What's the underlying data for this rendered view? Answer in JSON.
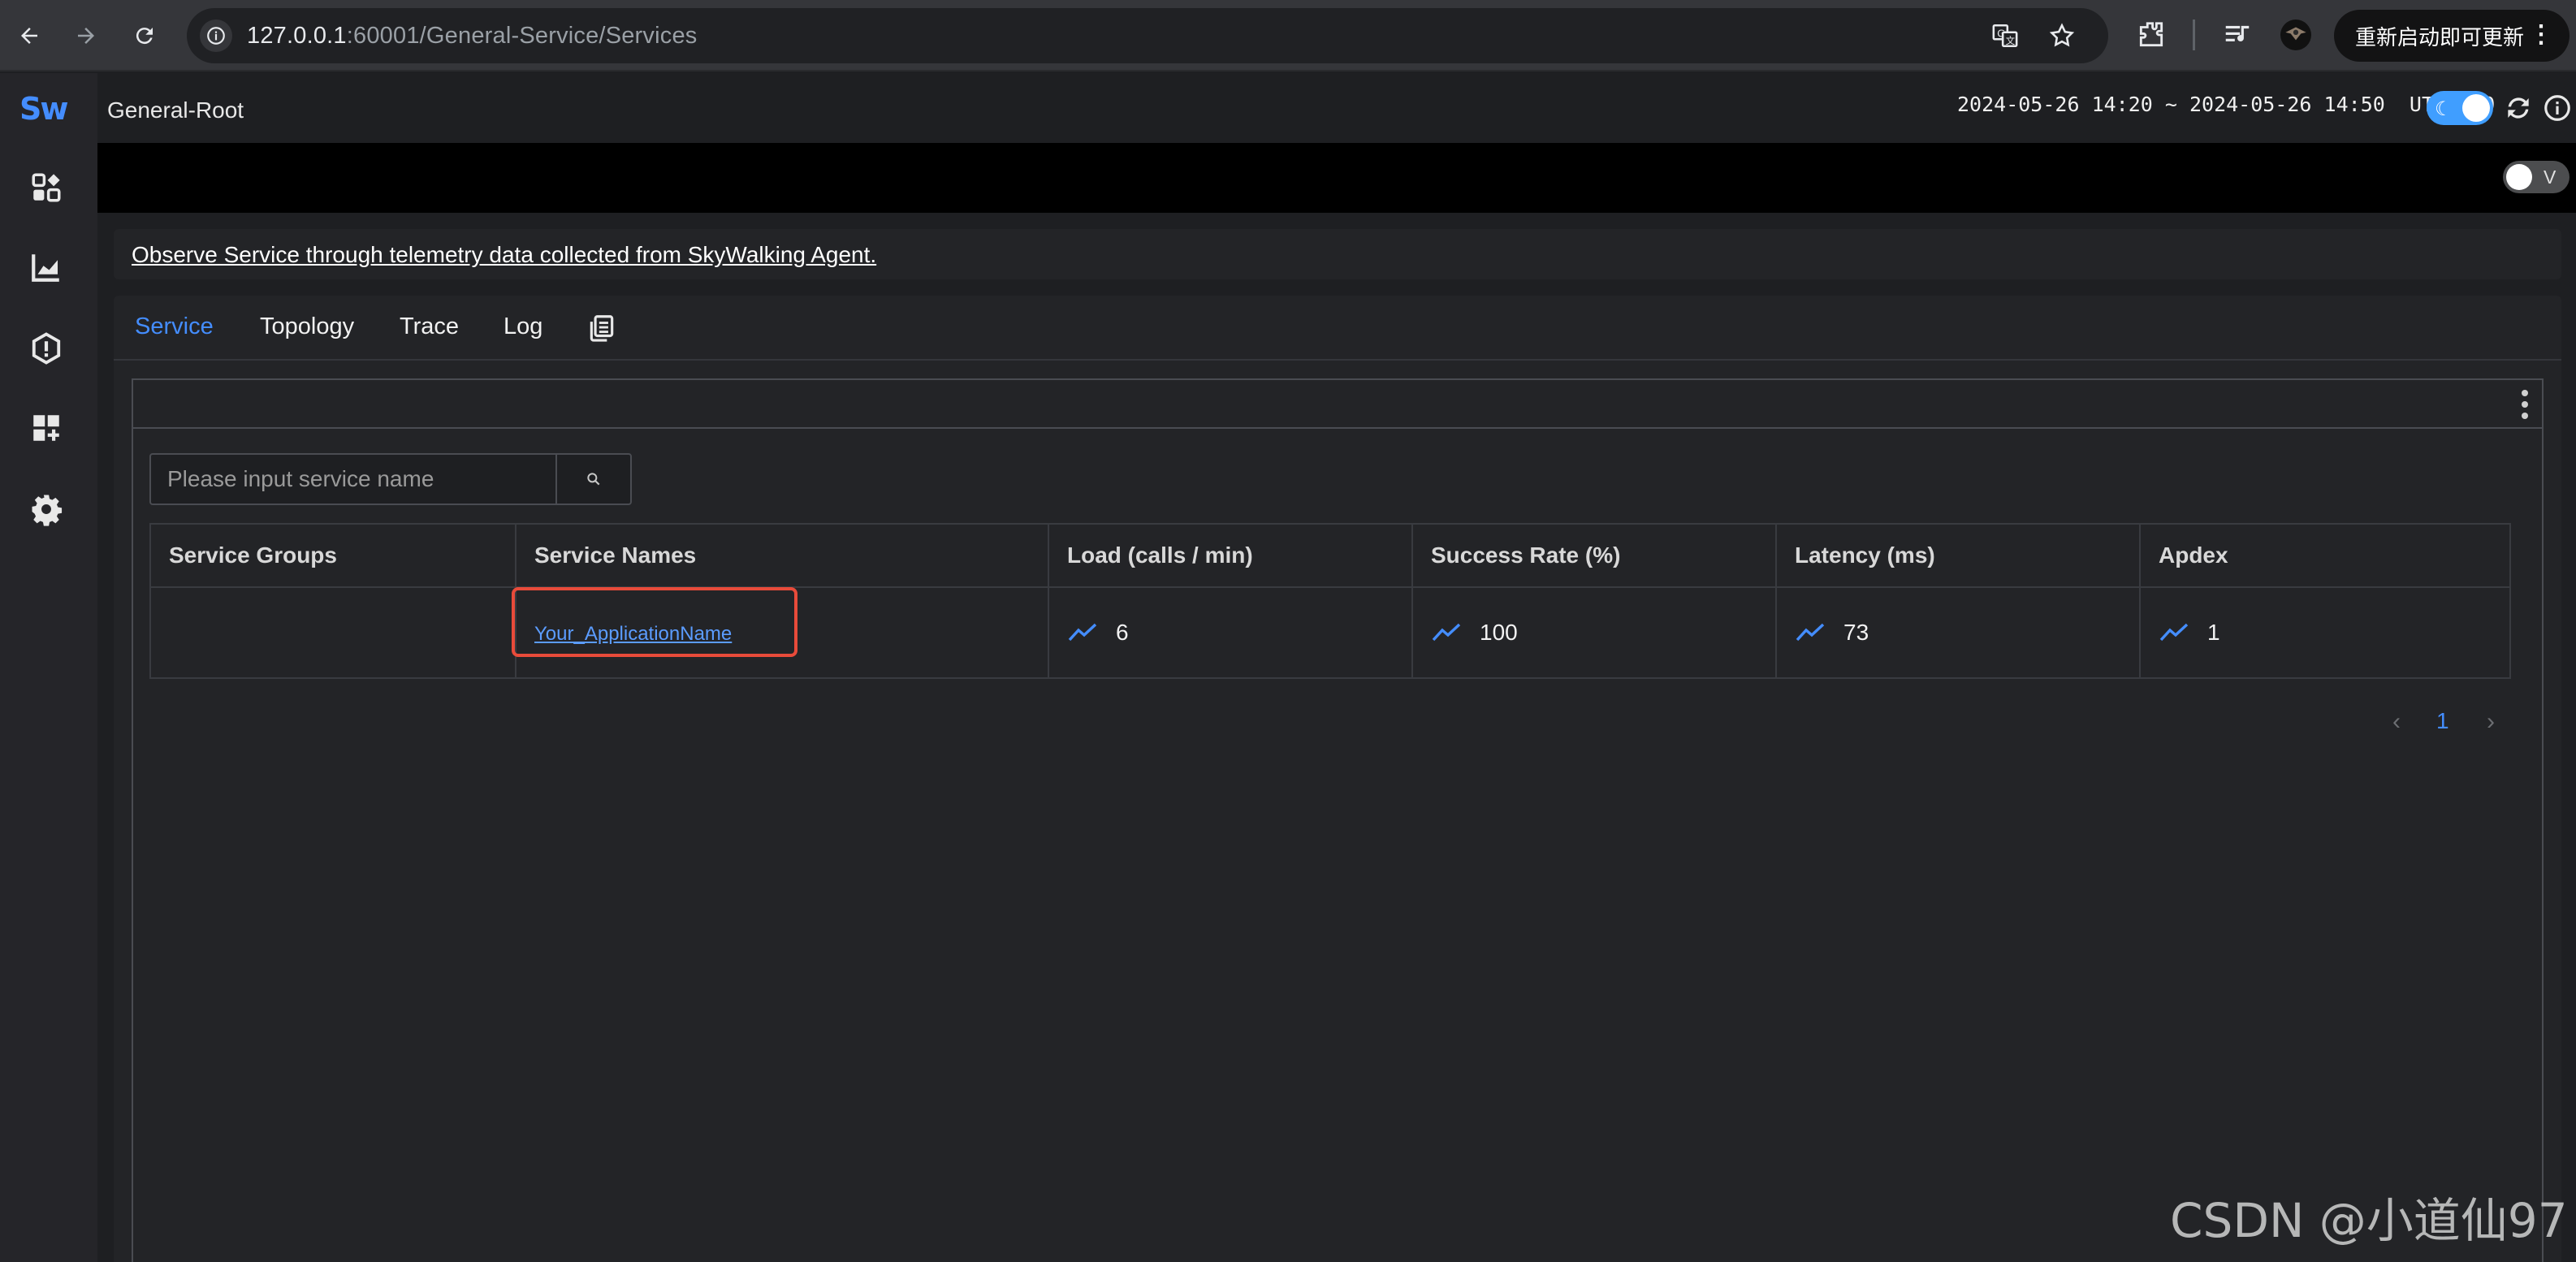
{
  "browser": {
    "url_host": "127.0.0.1",
    "url_rest": ":60001/General-Service/Services",
    "update_button": "重新启动即可更新",
    "update_more": "⋮"
  },
  "sidebar": {
    "logo": "Sw",
    "items": [
      {
        "icon": "dashboard-icon"
      },
      {
        "icon": "chart-icon"
      },
      {
        "icon": "alert-icon"
      },
      {
        "icon": "add-widget-icon"
      },
      {
        "icon": "settings-icon"
      }
    ]
  },
  "header": {
    "breadcrumb": "General-Root",
    "time_range": "2024-05-26 14:20 ~ 2024-05-26 14:50",
    "timezone": "UTC+8:0",
    "theme_toggle_on": true
  },
  "toolbar": {
    "v_toggle_label": "V",
    "v_toggle_on": false
  },
  "notice": "Observe Service through telemetry data collected from SkyWalking Agent.",
  "tabs": [
    {
      "label": "Service",
      "active": true
    },
    {
      "label": "Topology",
      "active": false
    },
    {
      "label": "Trace",
      "active": false
    },
    {
      "label": "Log",
      "active": false
    }
  ],
  "search": {
    "placeholder": "Please input service name",
    "value": ""
  },
  "table": {
    "columns": [
      "Service Groups",
      "Service Names",
      "Load (calls / min)",
      "Success Rate (%)",
      "Latency (ms)",
      "Apdex"
    ],
    "rows": [
      {
        "group": "",
        "name": "Your_ApplicationName",
        "load": "6",
        "success_rate": "100",
        "latency": "73",
        "apdex": "1"
      }
    ]
  },
  "pagination": {
    "current_page": "1",
    "prev": "‹",
    "next": "›"
  },
  "watermark": "CSDN @小道仙97",
  "colors": {
    "accent": "#448dfe",
    "highlight": "#e84b3a",
    "background": "#1e1f22",
    "panel": "#232427"
  }
}
